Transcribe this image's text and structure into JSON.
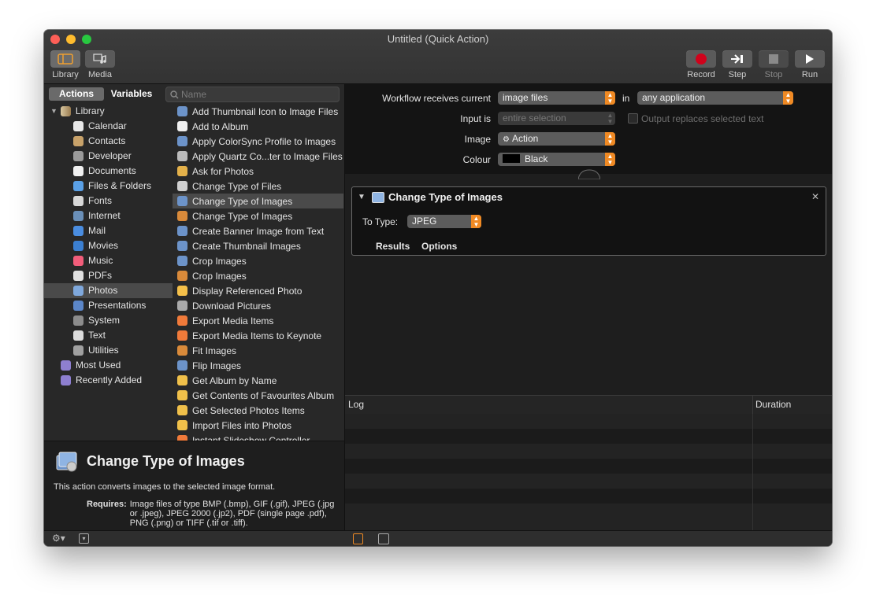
{
  "window": {
    "title": "Untitled (Quick Action)"
  },
  "toolbar": {
    "library_label": "Library",
    "media_label": "Media",
    "record_label": "Record",
    "step_label": "Step",
    "stop_label": "Stop",
    "run_label": "Run"
  },
  "left_pane": {
    "tabs": {
      "actions": "Actions",
      "variables": "Variables"
    },
    "search": {
      "placeholder": "Name",
      "value": ""
    },
    "library": {
      "root": "Library",
      "items": [
        {
          "label": "Calendar",
          "icon": "calendar-icon"
        },
        {
          "label": "Contacts",
          "icon": "contacts-icon"
        },
        {
          "label": "Developer",
          "icon": "developer-icon"
        },
        {
          "label": "Documents",
          "icon": "documents-icon"
        },
        {
          "label": "Files & Folders",
          "icon": "folder-icon"
        },
        {
          "label": "Fonts",
          "icon": "fonts-icon"
        },
        {
          "label": "Internet",
          "icon": "internet-icon"
        },
        {
          "label": "Mail",
          "icon": "mail-icon"
        },
        {
          "label": "Movies",
          "icon": "movies-icon"
        },
        {
          "label": "Music",
          "icon": "music-icon"
        },
        {
          "label": "PDFs",
          "icon": "pdf-icon"
        },
        {
          "label": "Photos",
          "icon": "photos-icon"
        },
        {
          "label": "Presentations",
          "icon": "presentations-icon"
        },
        {
          "label": "System",
          "icon": "system-icon"
        },
        {
          "label": "Text",
          "icon": "text-icon"
        },
        {
          "label": "Utilities",
          "icon": "utilities-icon"
        }
      ],
      "smart_groups": [
        "Most Used",
        "Recently Added"
      ],
      "selected": "Photos"
    },
    "actions": [
      "Add Thumbnail Icon to Image Files",
      "Add to Album",
      "Apply ColorSync Profile to Images",
      "Apply Quartz Co...ter to Image Files",
      "Ask for Photos",
      "Change Type of Files",
      "Change Type of Images",
      "Change Type of Images",
      "Create Banner Image from Text",
      "Create Thumbnail Images",
      "Crop Images",
      "Crop Images",
      "Display Referenced Photo",
      "Download Pictures",
      "Export Media Items",
      "Export Media Items to Keynote",
      "Fit Images",
      "Flip Images",
      "Get Album by Name",
      "Get Contents of Favourites Album",
      "Get Selected Photos Items",
      "Import Files into Photos",
      "Instant Slideshow Controller"
    ],
    "selected_action_index": 6,
    "description": {
      "title": "Change Type of Images",
      "text": "This action converts images to the selected image format.",
      "requires_label": "Requires:",
      "requires_text": "Image files of type BMP (.bmp), GIF (.gif), JPEG (.jpg or .jpeg), JPEG 2000 (.jp2), PDF (single page .pdf), PNG (.png) or TIFF (.tif or .tiff)."
    }
  },
  "workflow": {
    "receives_label": "Workflow receives current",
    "receives_value": "image files",
    "in_label": "in",
    "in_value": "any application",
    "input_is_label": "Input is",
    "input_is_value": "entire selection",
    "output_replaces_label": "Output replaces selected text",
    "image_label": "Image",
    "image_value": "Action",
    "colour_label": "Colour",
    "colour_value": "Black"
  },
  "action_card": {
    "title": "Change Type of Images",
    "to_type_label": "To Type:",
    "to_type_value": "JPEG",
    "results_label": "Results",
    "options_label": "Options"
  },
  "log": {
    "log_label": "Log",
    "duration_label": "Duration"
  },
  "colors": {
    "accent": "#f08a24",
    "record": "#d0021b"
  }
}
